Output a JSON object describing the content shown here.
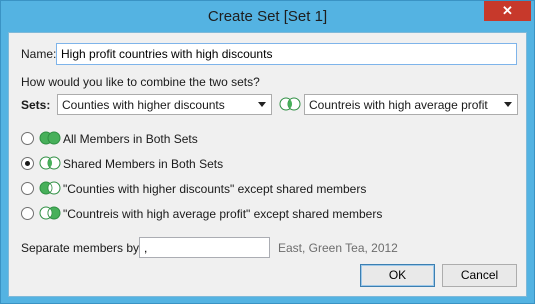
{
  "window": {
    "title": "Create Set [Set 1]",
    "close_glyph": "✕"
  },
  "name": {
    "label": "Name:",
    "value": "High profit countries with high discounts"
  },
  "combine": {
    "question": "How would you like to combine the two sets?",
    "sets_label": "Sets:",
    "set_a": "Counties with higher discounts",
    "set_b": "Countreis with high average profit",
    "swap_icon": "venn-swap-icon"
  },
  "options": [
    {
      "label": "All Members in Both Sets",
      "checked": false,
      "icon": "venn-union-icon"
    },
    {
      "label": "Shared Members in Both Sets",
      "checked": true,
      "icon": "venn-intersection-icon"
    },
    {
      "label": "\"Counties with higher discounts\" except shared members",
      "checked": false,
      "icon": "venn-left-only-icon"
    },
    {
      "label": "\"Countreis with high average profit\" except shared members",
      "checked": false,
      "icon": "venn-right-only-icon"
    }
  ],
  "separator": {
    "label": "Separate members by:",
    "value": ",",
    "example": "East, Green Tea, 2012"
  },
  "buttons": {
    "ok": "OK",
    "cancel": "Cancel"
  },
  "colors": {
    "title_bar": "#54b3e2",
    "close_button": "#c7392b",
    "venn_fill": "#47b05a",
    "venn_stroke": "#2f8f43"
  }
}
